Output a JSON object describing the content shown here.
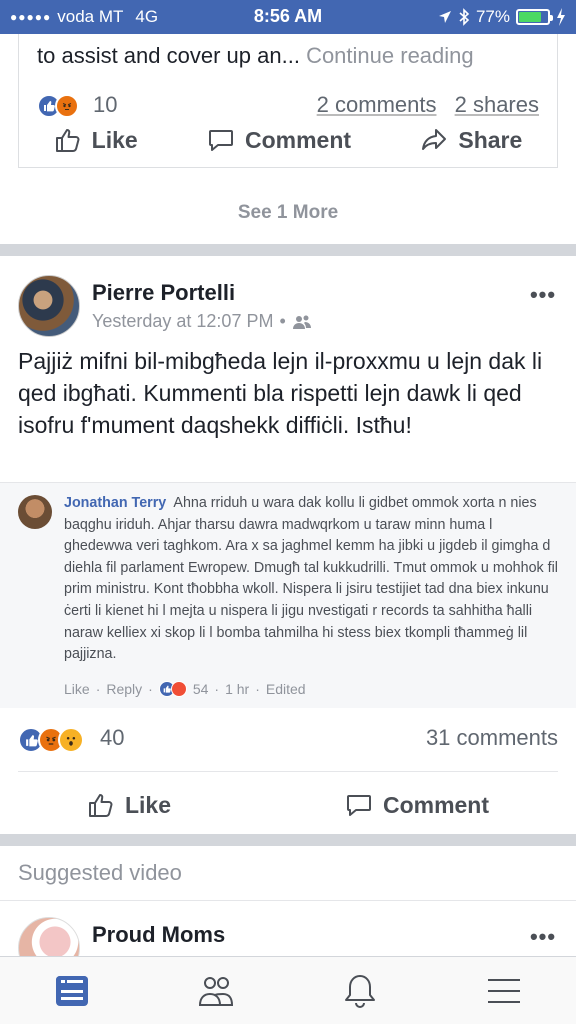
{
  "status_bar": {
    "signal": "●●●●●",
    "carrier": "voda MT",
    "network": "4G",
    "time": "8:56 AM",
    "battery": "77%",
    "battery_level": 0.77
  },
  "shared_post": {
    "text_line": "to assist and cover up an...",
    "continue_label": "Continue reading",
    "reaction_count": "10",
    "comments": "2 comments",
    "shares": "2 shares",
    "like_label": "Like",
    "comment_label": "Comment",
    "share_label": "Share"
  },
  "see_more": "See 1 More",
  "post": {
    "author": "Pierre Portelli",
    "timestamp": "Yesterday at 12:07 PM",
    "privacy_sep": "•",
    "text": "Pajjiż mifni bil-mibgħeda lejn il-proxxmu u lejn dak li qed ibgħati. Kummenti bla rispetti lejn dawk li qed isofru f'mument daqshekk diffiċli. Istħu!",
    "comment": {
      "name": "Jonathan Terry",
      "text": "Ahna rriduh u wara dak kollu li gidbet ommok xorta n nies baqghu iriduh. Ahjar tharsu dawra madwqrkom u taraw minn huma l ghedewwa veri taghkom. Ara x sa jaghmel kemm ha jibki u jigdeb il gimgha d diehla fil parlament Ewropew. Dmugħ tal kukkudrilli. Tmut ommok u mohhok fil prim ministru. Kont tħobbha wkoll. Nispera li jsiru testijiet tad dna biex inkunu ċerti li kienet hi l mejta u nispera li jigu nvestigati r records ta sahhitha ħalli naraw kelliex xi skop li l bomba tahmilha hi stess biex tkompli tħammeġ lil pajjizna.",
      "like": "Like",
      "reply": "Reply",
      "reactions": "54",
      "time": "1 hr",
      "edited": "Edited"
    },
    "reaction_count": "40",
    "comments": "31 comments",
    "like_label": "Like",
    "comment_label": "Comment"
  },
  "suggested": {
    "header": "Suggested video",
    "page_name": "Proud Moms"
  },
  "colors": {
    "brand": "#4267b2",
    "link": "#4267b2",
    "muted": "#90949c"
  }
}
